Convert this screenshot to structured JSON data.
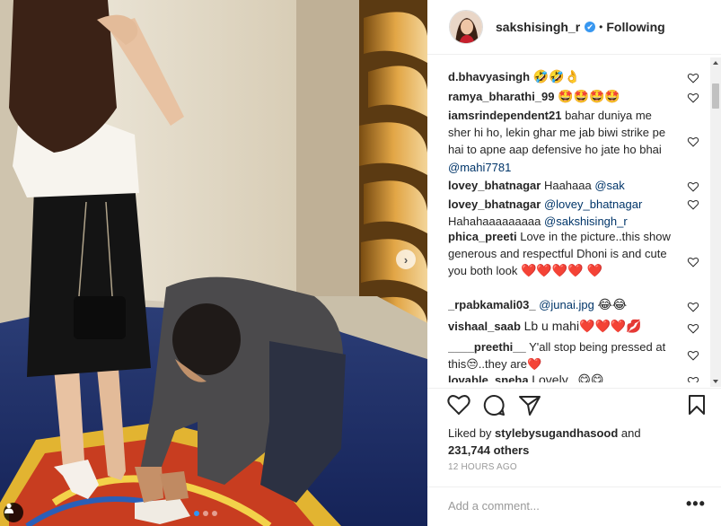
{
  "post": {
    "author": "sakshisingh_r",
    "separator": "•",
    "follow_status": "Following",
    "verified_mark": "✔",
    "next_arrow": "›"
  },
  "comments": [
    {
      "user": "d.bhavyasingh",
      "text": "🤣🤣👌"
    },
    {
      "user": "ramya_bharathi_99",
      "text": "🤩🤩🤩🤩"
    },
    {
      "user": "iamsrindependent21",
      "text": "bahar duniya me sher hi ho, lekin ghar me jab biwi strike pe hai to apne aap defensive ho jate ho bhai",
      "mention": "@mahi7781"
    },
    {
      "user": "lovey_bhatnagar",
      "text": "Haahaaa",
      "mention": "@sak"
    },
    {
      "user": "lovey_bhatnagar",
      "mention": "@lovey_bhatnagar",
      "text": "Hahahaaaaaaaaa",
      "mention2": "@sakshisingh_r"
    },
    {
      "user": "phica_preeti",
      "text": "Love in the picture..this show generous and respectful Dhoni is and cute you both look",
      "emoji": "❤️❤️❤️❤️ ❤️"
    },
    {
      "user": "_rpabkamali03_",
      "mention": "@junai.jpg",
      "text": "😂😂"
    },
    {
      "user": "vishaal_saab",
      "text": "Lb u mahi❤️❤️❤️💋"
    },
    {
      "user": "____preethi__",
      "text": "Y'all stop being pressed at this😒..they are❤️"
    },
    {
      "user": "lovable_sneha",
      "text": "Lovely...😋😋"
    }
  ],
  "likes": {
    "prefix": "Liked by",
    "user": "stylebysugandhasood",
    "middle": "and",
    "count": "231,744 others"
  },
  "timestamp": "12 HOURS AGO",
  "comment_box": {
    "placeholder": "Add a comment...",
    "more": "•••"
  },
  "icons": [
    "heart-icon",
    "comment-icon",
    "share-icon",
    "bookmark-icon",
    "more-options-icon",
    "tag-people-icon",
    "next-arrow-icon"
  ],
  "colors": {
    "accent": "#3897f0",
    "mention": "#003569",
    "muted": "#999999",
    "dot_active": "#2f95f6"
  }
}
